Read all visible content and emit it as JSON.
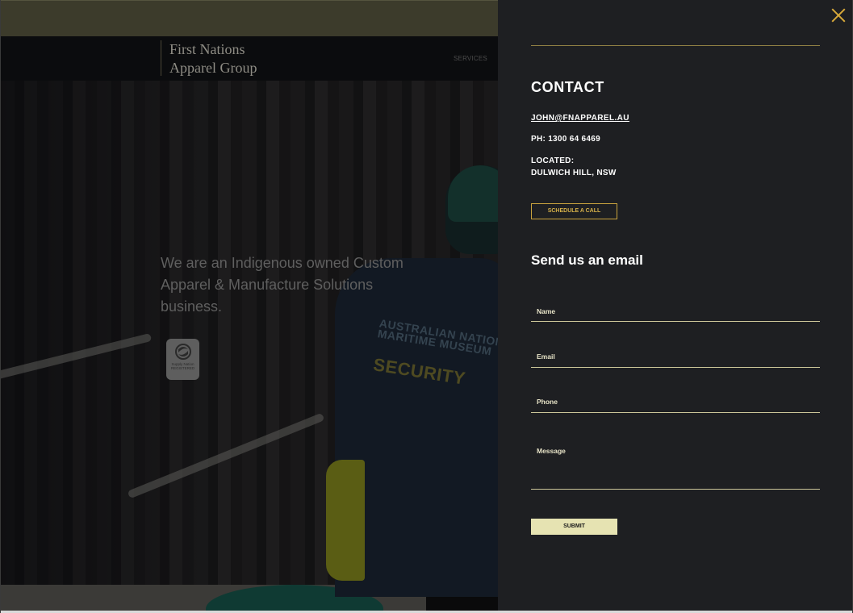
{
  "background_page": {
    "brand": {
      "line1": "First Nations",
      "line2": "Apparel Group"
    },
    "nav": {
      "services": "SERVICES"
    },
    "hero": {
      "headline": "We are an Indigenous owned Custom Apparel & Manufacture Solutions business.",
      "badge": {
        "line1": "Supply Nation",
        "line2": "REGISTERED"
      },
      "jacket": {
        "line1": "AUSTRALIAN NATIONAL",
        "line2": "MARITIME MUSEUM",
        "line3": "SECURITY"
      }
    },
    "social": {
      "icon": "instagram-icon"
    }
  },
  "drawer": {
    "close_icon": "close-icon",
    "title": "CONTACT",
    "email": "JOHN@FNAPPAREL.AU",
    "phone": "PH: 1300 64 6469",
    "located_label": "LOCATED:",
    "located_value": "DULWICH HILL, NSW",
    "schedule_label": "SCHEDULE A CALL",
    "form_heading": "Send us an email",
    "form": {
      "name_placeholder": "Name",
      "email_placeholder": "Email",
      "phone_placeholder": "Phone",
      "message_placeholder": "Message",
      "submit_label": "SUBMIT"
    }
  },
  "colors": {
    "drawer_bg": "#1e1f22",
    "accent_gold": "#d7a93a",
    "field_line": "#cdc79a",
    "submit_bg": "#e6e3b2"
  }
}
